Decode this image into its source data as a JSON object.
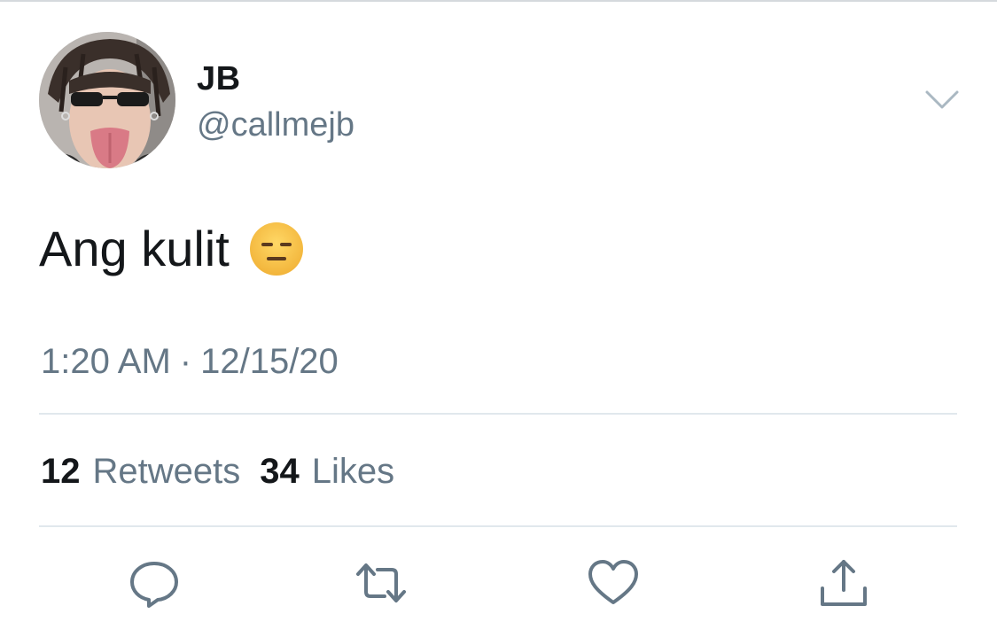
{
  "author": {
    "display_name": "JB",
    "handle": "@callmejb"
  },
  "tweet": {
    "text": "Ang kulit",
    "emoji": "expressionless-face"
  },
  "meta": {
    "time": "1:20 AM",
    "separator": "·",
    "date": "12/15/20"
  },
  "stats": {
    "retweets_count": "12",
    "retweets_label": "Retweets",
    "likes_count": "34",
    "likes_label": "Likes"
  },
  "actions": [
    "reply-icon",
    "retweet-icon",
    "like-icon",
    "share-icon"
  ],
  "colors": {
    "text": "#14171a",
    "secondary": "#657786",
    "divider": "#e1e8ed",
    "emoji_face": "#f6c443"
  }
}
